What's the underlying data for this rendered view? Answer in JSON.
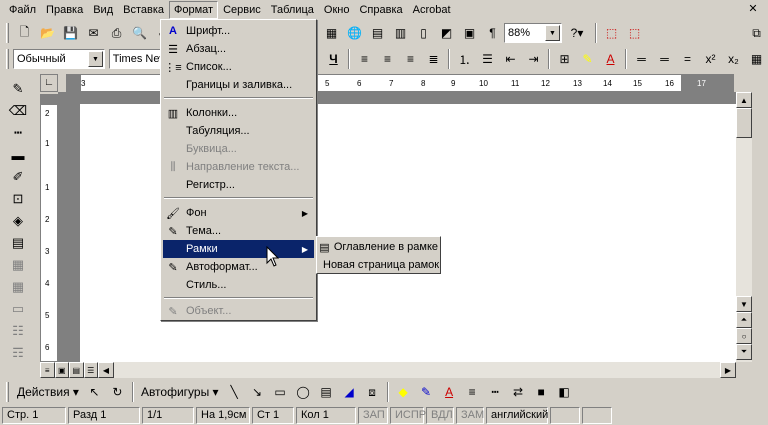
{
  "menubar": {
    "items": [
      "Файл",
      "Правка",
      "Вид",
      "Вставка",
      "Формат",
      "Сервис",
      "Таблица",
      "Окно",
      "Справка",
      "Acrobat"
    ],
    "open_index": 4
  },
  "toolbar": {
    "zoom": "88%",
    "help_button": "?",
    "paragraph_mark": "¶"
  },
  "formatting": {
    "style": "Обычный",
    "font": "Times New R"
  },
  "ruler": {
    "h_numbers": [
      "3",
      "5",
      "6",
      "7",
      "8",
      "9",
      "10",
      "11",
      "12",
      "13",
      "14",
      "15",
      "16",
      "17"
    ],
    "v_numbers": [
      "2",
      "1",
      "1",
      "2",
      "3",
      "4",
      "5",
      "6"
    ]
  },
  "format_menu": {
    "items": [
      {
        "label": "Шрифт...",
        "icon": "font-icon",
        "disabled": false,
        "submenu": false
      },
      {
        "label": "Абзац...",
        "icon": "paragraph-icon",
        "disabled": false,
        "submenu": false
      },
      {
        "label": "Список...",
        "icon": "list-icon",
        "disabled": false,
        "submenu": false
      },
      {
        "label": "Границы и заливка...",
        "icon": "",
        "disabled": false,
        "submenu": false
      },
      {
        "label": "Колонки...",
        "icon": "columns-icon",
        "disabled": false,
        "submenu": false
      },
      {
        "label": "Табуляция...",
        "icon": "",
        "disabled": false,
        "submenu": false
      },
      {
        "label": "Буквица...",
        "icon": "",
        "disabled": true,
        "submenu": false
      },
      {
        "label": "Направление текста...",
        "icon": "text-direction-icon",
        "disabled": true,
        "submenu": false
      },
      {
        "label": "Регистр...",
        "icon": "",
        "disabled": false,
        "submenu": false
      },
      {
        "label": "Фон",
        "icon": "background-icon",
        "disabled": false,
        "submenu": true
      },
      {
        "label": "Тема...",
        "icon": "theme-icon",
        "disabled": false,
        "submenu": false
      },
      {
        "label": "Рамки",
        "icon": "",
        "disabled": false,
        "submenu": true,
        "highlighted": true
      },
      {
        "label": "Автоформат...",
        "icon": "autoformat-icon",
        "disabled": false,
        "submenu": false
      },
      {
        "label": "Стиль...",
        "icon": "",
        "disabled": false,
        "submenu": false
      },
      {
        "label": "Объект...",
        "icon": "object-icon",
        "disabled": true,
        "submenu": false
      }
    ]
  },
  "frames_submenu": {
    "items": [
      "Оглавление в рамке",
      "Новая страница рамок"
    ]
  },
  "drawing": {
    "actions": "Действия",
    "autoshapes": "Автофигуры"
  },
  "status": {
    "page": "Стр. 1",
    "section": "Разд 1",
    "pages": "1/1",
    "position": "На 1,9см",
    "line": "Ст 1",
    "column": "Кол 1",
    "rec": "ЗАП",
    "trk": "ИСПР",
    "ext": "ВДЛ",
    "ovr": "ЗАМ",
    "language": "английский"
  }
}
